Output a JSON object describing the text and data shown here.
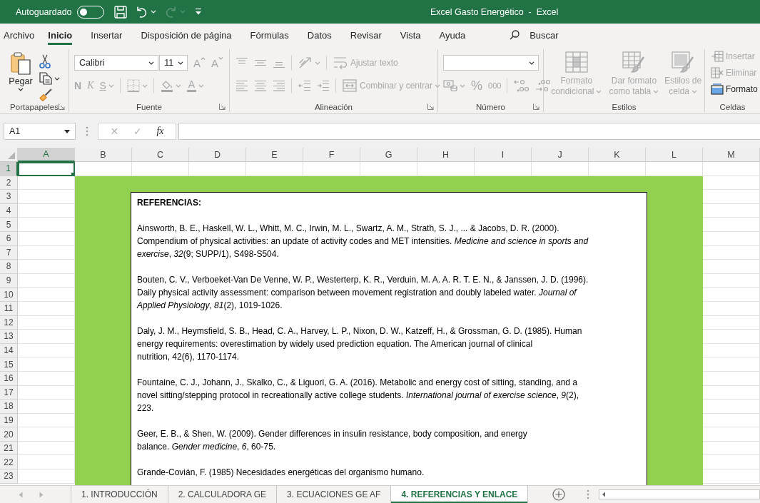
{
  "title_bar": {
    "autosave": {
      "label": "Autoguardado",
      "on": false
    },
    "quick_access": [
      {
        "kind": "save",
        "disabled": false,
        "dropdown": false
      },
      {
        "kind": "undo",
        "disabled": false,
        "dropdown": true
      },
      {
        "kind": "redo",
        "disabled": true,
        "dropdown": true
      },
      {
        "kind": "customize",
        "disabled": false,
        "dropdown": false
      }
    ],
    "title": "Excel Gasto Energético  -  Excel"
  },
  "ribbon_tabs": [
    {
      "label": "Archivo",
      "selected": false
    },
    {
      "label": "Inicio",
      "selected": true
    },
    {
      "label": "Insertar",
      "selected": false
    },
    {
      "label": "Disposición de página",
      "selected": false
    },
    {
      "label": "Fórmulas",
      "selected": false
    },
    {
      "label": "Datos",
      "selected": false
    },
    {
      "label": "Revisar",
      "selected": false
    },
    {
      "label": "Vista",
      "selected": false
    },
    {
      "label": "Ayuda",
      "selected": false
    }
  ],
  "search": {
    "label": "Buscar"
  },
  "ribbon": {
    "clipboard": {
      "label": "Portapapeles",
      "launcher": true,
      "paste": {
        "label": "Pegar",
        "disabled": false
      },
      "tools": [
        {
          "kind": "cut",
          "disabled": false,
          "dropdown": false
        },
        {
          "kind": "copy",
          "disabled": false,
          "dropdown": true
        },
        {
          "kind": "painter",
          "disabled": false,
          "dropdown": false
        }
      ]
    },
    "font": {
      "label": "Fuente",
      "launcher": true,
      "font_name": "Calibri",
      "font_size": "11",
      "row1": [
        {
          "kind": "grow",
          "label": "A",
          "disabled": true
        },
        {
          "kind": "shrink",
          "label": "A",
          "disabled": true
        }
      ],
      "row2": [
        [
          {
            "kind": "bold",
            "label": "N",
            "disabled": true
          },
          {
            "kind": "italic",
            "label": "K",
            "disabled": true
          },
          {
            "kind": "underline",
            "label": "S",
            "disabled": true,
            "dropdown": true
          }
        ],
        [
          {
            "kind": "borders",
            "disabled": true,
            "dropdown": true
          }
        ],
        [
          {
            "kind": "fill",
            "disabled": true,
            "dropdown": true
          },
          {
            "kind": "color",
            "label": "A",
            "disabled": true,
            "dropdown": true
          }
        ]
      ]
    },
    "alignment": {
      "label": "Alineación",
      "launcher": true,
      "row1": [
        [
          {
            "kind": "top",
            "disabled": true
          },
          {
            "kind": "middle",
            "disabled": true
          },
          {
            "kind": "bottom",
            "disabled": true
          }
        ],
        [
          {
            "kind": "orientation",
            "disabled": true,
            "dropdown": true
          }
        ],
        [
          {
            "kind": "wrap",
            "label": "Ajustar texto",
            "disabled": true
          }
        ]
      ],
      "row2": [
        [
          {
            "kind": "left",
            "disabled": true
          },
          {
            "kind": "center",
            "disabled": true
          },
          {
            "kind": "right",
            "disabled": true
          }
        ],
        [
          {
            "kind": "outdent",
            "disabled": true
          },
          {
            "kind": "indent",
            "disabled": true
          }
        ],
        [
          {
            "kind": "merge",
            "label": "Combinar y centrar",
            "disabled": true,
            "dropdown": true
          }
        ]
      ]
    },
    "number": {
      "label": "Número",
      "launcher": true,
      "row2": [
        [
          {
            "kind": "accounting",
            "disabled": true,
            "dropdown": true
          },
          {
            "kind": "percent",
            "label": "%",
            "disabled": true
          },
          {
            "kind": "thousands",
            "label": "000",
            "disabled": true
          }
        ],
        [
          {
            "kind": "moredecimals",
            "disabled": true
          },
          {
            "kind": "fewerdecimals",
            "disabled": true
          }
        ]
      ]
    },
    "styles": {
      "label": "Estilos",
      "launcher": false,
      "buttons": [
        {
          "kind": "conditional",
          "label": "Formato condicional",
          "disabled": true,
          "dropdown": true
        },
        {
          "kind": "table",
          "label": "Dar formato como tabla",
          "disabled": true,
          "dropdown": true
        },
        {
          "kind": "cellstyles",
          "label": "Estilos de celda",
          "disabled": true,
          "dropdown": true
        }
      ]
    },
    "cells": {
      "label": "Celdas",
      "launcher": false,
      "buttons": [
        {
          "kind": "insert",
          "label": "Insertar",
          "disabled": true
        },
        {
          "kind": "delete",
          "label": "Eliminar",
          "disabled": true
        },
        {
          "kind": "format",
          "label": "Formato",
          "disabled": false
        }
      ]
    }
  },
  "formula_bar": {
    "name_box": "A1",
    "buttons": [
      {
        "kind": "cancel",
        "label": "✕",
        "disabled": true
      },
      {
        "kind": "enter",
        "label": "✓",
        "disabled": true
      },
      {
        "kind": "function",
        "label": "fx",
        "disabled": false
      }
    ]
  },
  "sheet": {
    "columns": [
      {
        "label": "A",
        "selected": true
      },
      {
        "label": "B",
        "selected": false
      },
      {
        "label": "C",
        "selected": false
      },
      {
        "label": "D",
        "selected": false
      },
      {
        "label": "E",
        "selected": false
      },
      {
        "label": "F",
        "selected": false
      },
      {
        "label": "G",
        "selected": false
      },
      {
        "label": "H",
        "selected": false
      },
      {
        "label": "I",
        "selected": false
      },
      {
        "label": "J",
        "selected": false
      },
      {
        "label": "K",
        "selected": false
      },
      {
        "label": "L",
        "selected": false
      },
      {
        "label": "M",
        "selected": false
      }
    ],
    "rows": [
      {
        "label": "1",
        "selected": true
      },
      {
        "label": "2",
        "selected": false
      },
      {
        "label": "3",
        "selected": false
      },
      {
        "label": "4",
        "selected": false
      },
      {
        "label": "5",
        "selected": false
      },
      {
        "label": "6",
        "selected": false
      },
      {
        "label": "7",
        "selected": false
      },
      {
        "label": "8",
        "selected": false
      },
      {
        "label": "9",
        "selected": false
      },
      {
        "label": "10",
        "selected": false
      },
      {
        "label": "11",
        "selected": false
      },
      {
        "label": "12",
        "selected": false
      },
      {
        "label": "13",
        "selected": false
      },
      {
        "label": "14",
        "selected": false
      },
      {
        "label": "15",
        "selected": false
      },
      {
        "label": "16",
        "selected": false
      },
      {
        "label": "17",
        "selected": false
      },
      {
        "label": "18",
        "selected": false
      },
      {
        "label": "19",
        "selected": false
      },
      {
        "label": "20",
        "selected": false
      },
      {
        "label": "21",
        "selected": false
      },
      {
        "label": "22",
        "selected": false
      },
      {
        "label": "23",
        "selected": false
      }
    ]
  },
  "text_box": {
    "heading": "REFERENCIAS:",
    "references": [
      "Ainsworth, B. E., Haskell, W. L., Whitt, M. C., Irwin, M. L., Swartz, A. M., Strath, S. J., ... & Jacobs, D. R. (2000).\nCompendium of physical activities: an update of activity codes and MET intensities. *Medicine and science in sports and*\n*exercise*, *32*(9; SUPP/1), S498-S504.",
      "Bouten, C. V., Verboeket-Van De Venne, W. P., Westerterp, K. R., Verduin, M. A. A. R. T. E. N., & Janssen, J. D. (1996).\nDaily physical activity assessment: comparison between movement registration and doubly labeled water. *Journal of*\n*Applied Physiology*, *81*(2), 1019-1026.",
      "Daly, J. M., Heymsfield, S. B., Head, C. A., Harvey, L. P., Nixon, D. W., Katzeff, H., & Grossman, G. D. (1985). Human\nenergy requirements: overestimation by widely used prediction equation. The American journal of clinical\nnutrition, 42(6), 1170-1174.",
      "Fountaine, C. J., Johann, J., Skalko, C., & Liguori, G. A. (2016). Metabolic and energy cost of sitting, standing, and a\nnovel sitting/stepping protocol in recreationally active college students. *International journal of exercise science*, *9*(2),\n223.",
      "Geer, E. B., & Shen, W. (2009). Gender differences in insulin resistance, body composition, and energy\nbalance. *Gender medicine*, *6*, 60-75.",
      "Grande-Covián, F. (1985) Necesidades energéticas del organismo humano."
    ]
  },
  "sheet_tabs": {
    "nav": [
      {
        "kind": "previous",
        "disabled": true
      },
      {
        "kind": "next",
        "disabled": true
      }
    ],
    "tabs": [
      {
        "label": "1. INTRODUCCIÓN",
        "selected": false
      },
      {
        "label": "2. CALCULADORA GE",
        "selected": false
      },
      {
        "label": "3. ECUACIONES GE AF",
        "selected": false
      },
      {
        "label": "4. REFERENCIAS Y ENLACE",
        "selected": true
      }
    ]
  }
}
